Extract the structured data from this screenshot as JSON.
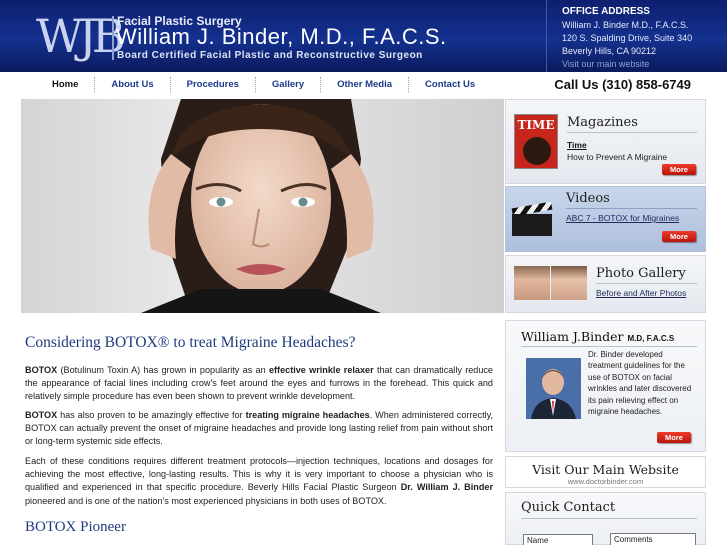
{
  "header": {
    "logo": "WJB",
    "tagline": "Facial Plastic Surgery",
    "name": "William J. Binder, M.D., F.A.C.S.",
    "subtitle": "Board Certified Facial Plastic and Reconstructive Surgeon",
    "office": {
      "title": "OFFICE ADDRESS",
      "line1": "William J. Binder M.D., F.A.C.S.",
      "line2": "120 S. Spalding Drive, Suite 340",
      "line3": "Beverly Hills, CA 90212",
      "link": "Visit our main website"
    }
  },
  "nav": {
    "items": [
      "Home",
      "About Us",
      "Procedures",
      "Gallery",
      "Other Media",
      "Contact Us"
    ],
    "active": "Home",
    "phone": "Call Us (310) 858-6749"
  },
  "panels": {
    "magazines": {
      "title": "Magazines",
      "source": "Time",
      "article": "How to Prevent A Migraine",
      "more": "More",
      "thumb_text": "TIME"
    },
    "videos": {
      "title": "Videos",
      "link": "ABC 7 - BOTOX for Migraines",
      "more": "More"
    },
    "gallery": {
      "title": "Photo Gallery",
      "link": "Before and After Photos"
    }
  },
  "article": {
    "heading": "Considering BOTOX® to treat Migraine Headaches?",
    "p1_b1": "BOTOX",
    "p1_t1": " (Botulinum Toxin A) has grown in popularity as an ",
    "p1_b2": "effective wrinkle relaxer",
    "p1_t2": " that can dramatically reduce the appearance of facial lines including crow's feet around the eyes and furrows in the forehead. This quick and relatively simple procedure has even been shown to prevent wrinkle development.",
    "p2_b1": "BOTOX",
    "p2_t1": " has also proven to be amazingly effective for ",
    "p2_b2": "treating migraine headaches",
    "p2_t2": ". When administered correctly, BOTOX can actually prevent the onset of migraine headaches and provide long lasting relief from pain without short or long-term systemic side effects.",
    "p3_t1": "Each of these conditions requires different treatment protocols—injection techniques, locations and dosages for achieving the most effective, long-lasting results.  This is why it is very important to choose a physician who is qualified and experienced in that specific procedure. Beverly Hills Facial Plastic Surgeon ",
    "p3_b1": "Dr. William J. Binder",
    "p3_t2": " pioneered and is one of the nation's most experienced physicians in both uses of BOTOX.",
    "heading2": "BOTOX Pioneer"
  },
  "doctor": {
    "name": "William J.Binder",
    "creds": "M.D, F.A.C.S",
    "text": "Dr. Binder developed treatment guidelines for the use of BOTOX on facial wrinkles and later discovered its pain relieving effect on migraine headaches.",
    "more": "More"
  },
  "site": {
    "title": "Visit Our Main Website",
    "url": "www.doctorbinder.com"
  },
  "quick_contact": {
    "title": "Quick Contact",
    "name_placeholder": "Name",
    "comments_placeholder": "Comments"
  },
  "colors": {
    "header_navy": "#14318f",
    "heading_blue": "#1f3a7c",
    "more_red": "#d8261a"
  }
}
